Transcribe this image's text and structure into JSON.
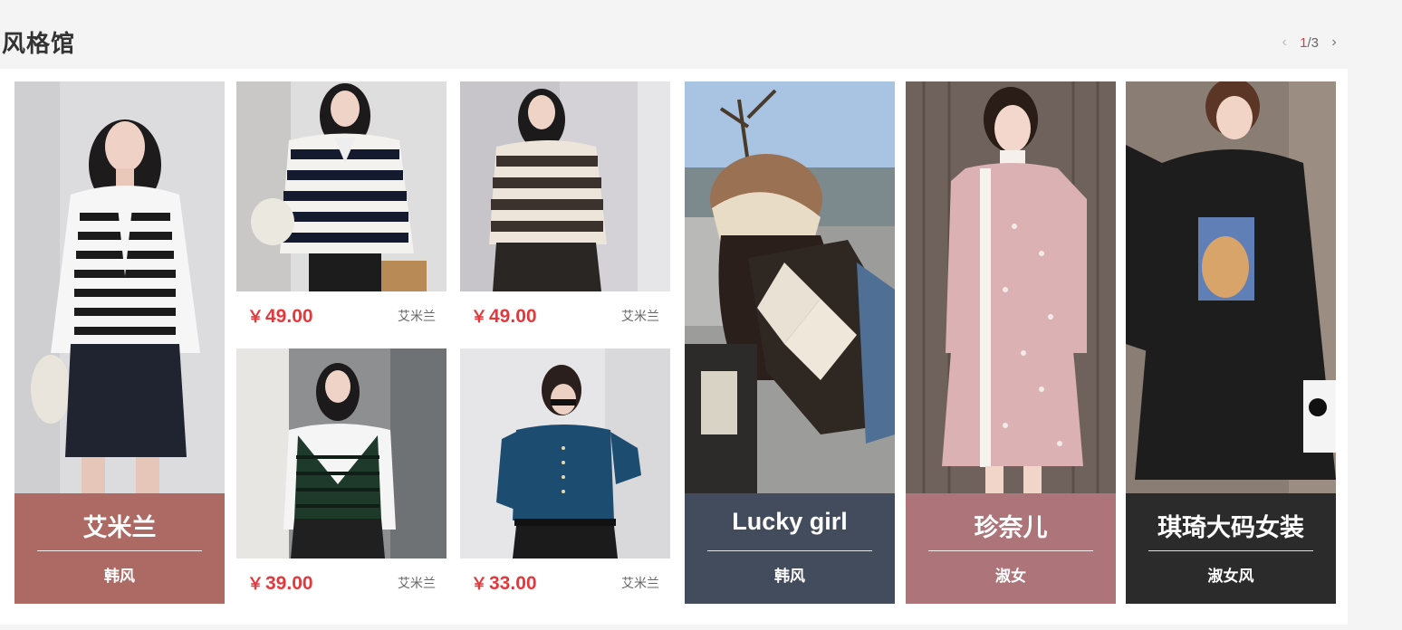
{
  "section": {
    "title": "风格馆"
  },
  "pager": {
    "current": "1",
    "total": "/3",
    "prev_icon": "chevron-left-icon",
    "next_icon": "chevron-right-icon"
  },
  "cards": [
    {
      "brand": "艾米兰",
      "style": "韩风",
      "caption_color": "#ad6a64"
    },
    {
      "brand": "Lucky girl",
      "style": "韩风",
      "caption_color": "#434c5c"
    },
    {
      "brand": "珍奈儿",
      "style": "淑女",
      "caption_color": "#ad757a"
    },
    {
      "brand": "琪琦大码女装",
      "style": "淑女风",
      "caption_color": "#2b2b2b"
    }
  ],
  "products": [
    {
      "price": "49.00",
      "currency": "￥",
      "shop": "艾米兰"
    },
    {
      "price": "49.00",
      "currency": "￥",
      "shop": "艾米兰"
    },
    {
      "price": "39.00",
      "currency": "￥",
      "shop": "艾米兰"
    },
    {
      "price": "33.00",
      "currency": "￥",
      "shop": "艾米兰"
    }
  ]
}
